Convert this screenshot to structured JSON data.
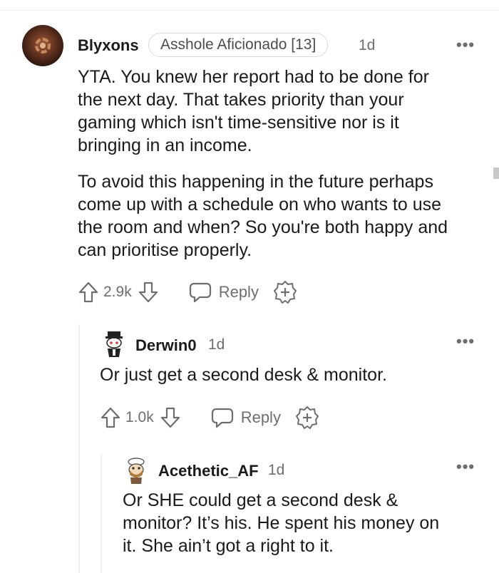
{
  "comment1": {
    "username": "Blyxons",
    "flair": "Asshole Aficionado [13]",
    "time": "1d",
    "more": "•••",
    "paragraph1_lines": [
      "YTA. You knew her report had to be done for",
      "the next day. That takes priority than your",
      "gaming which isn't time-sensitive nor is it",
      "bringing in an income."
    ],
    "paragraph2_lines": [
      "To avoid this happening in the future perhaps",
      "come up with a schedule on who wants to use",
      "the room and when? So you're both happy and",
      "can prioritise properly."
    ],
    "score": "2.9k",
    "reply_label": "Reply"
  },
  "comment2": {
    "username": "Derwin0",
    "time": "1d",
    "more": "•••",
    "body": "Or just get a second desk & monitor.",
    "score": "1.0k",
    "reply_label": "Reply"
  },
  "comment3": {
    "username": "Acethetic_AF",
    "time": "1d",
    "more": "•••",
    "body_lines": [
      "Or SHE could get a second desk &",
      "monitor? It’s his. He spent his money on",
      "it. She ain’t got a right to it."
    ]
  },
  "colors": {
    "text": "#1a1a1b",
    "meta": "#6b6e72",
    "thread_line": "#edeff1"
  },
  "icons": [
    "upvote-icon",
    "downvote-icon",
    "reply-icon",
    "award-icon",
    "more-options-icon",
    "avatar-snoo"
  ]
}
